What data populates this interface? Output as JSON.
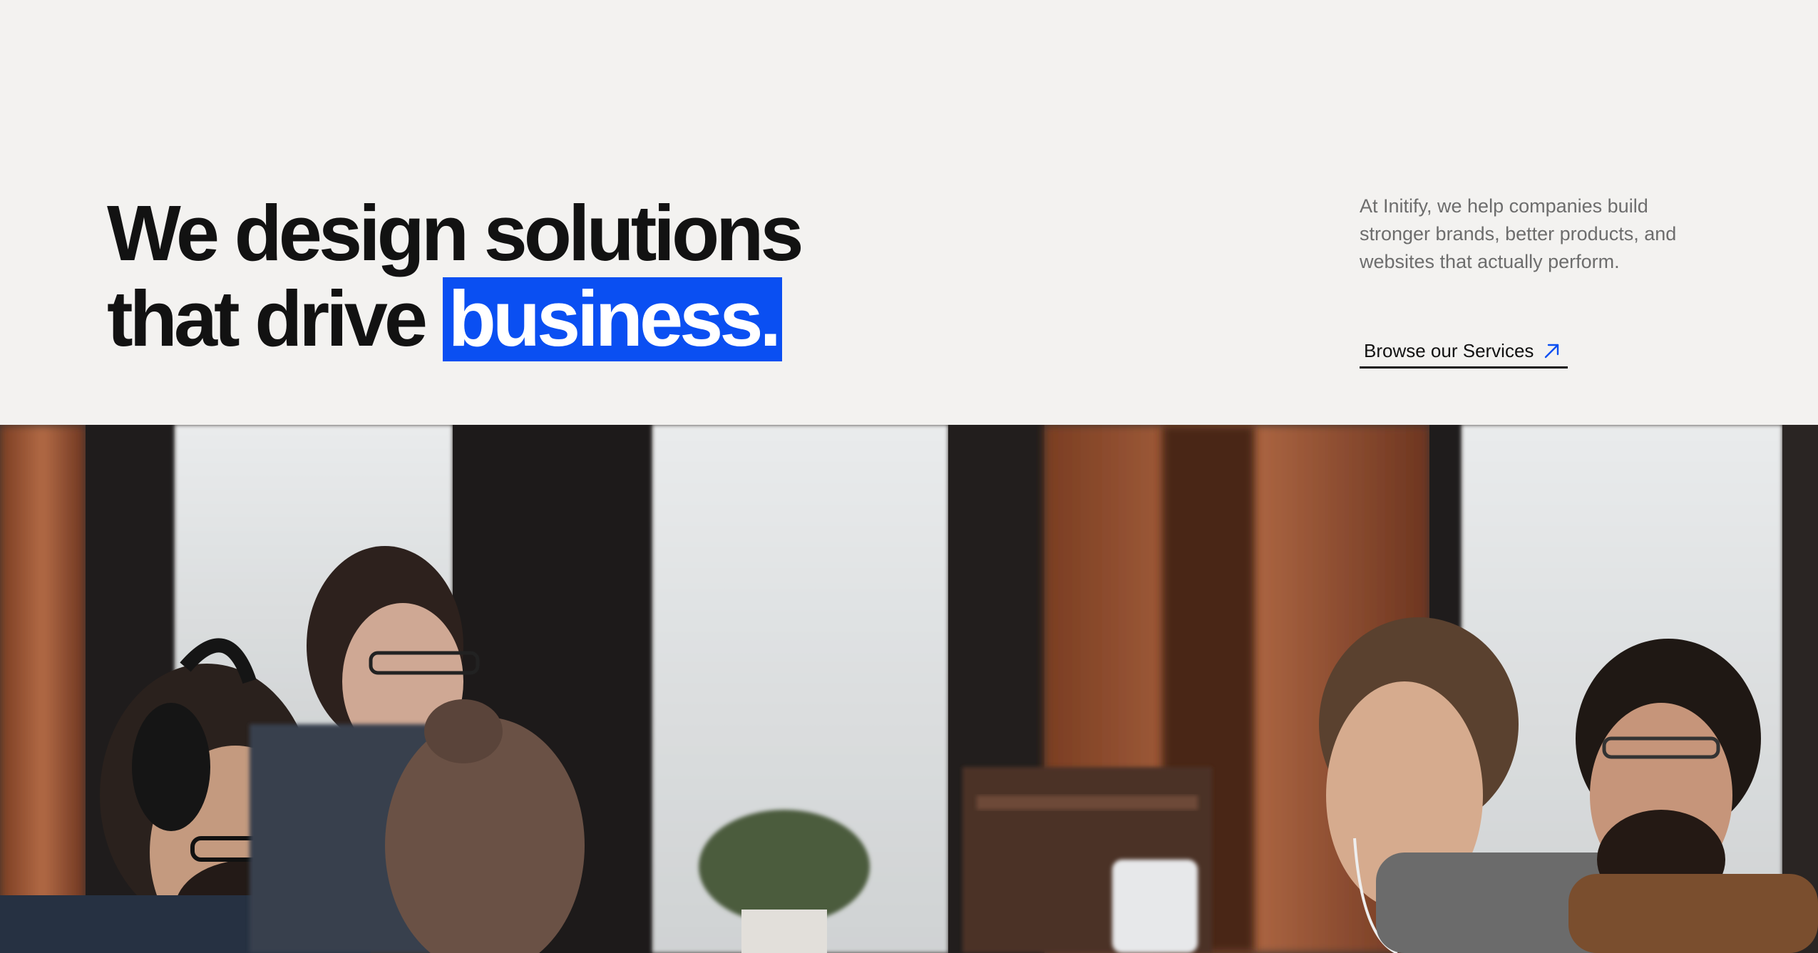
{
  "hero": {
    "headline_line1": "We design solutions",
    "headline_line2_prefix": "that drive ",
    "headline_highlight": "business.",
    "intro_text": "At Initify, we help companies build stronger brands, better products, and websites that actually perform.",
    "cta_label": "Browse our Services",
    "cta_icon": "arrow-up-right-icon"
  },
  "colors": {
    "background": "#f3f2f0",
    "highlight": "#0a4ff2",
    "text": "#121212",
    "muted_text": "#6d6d6d"
  },
  "photo": {
    "subject": "team-working-photo"
  }
}
